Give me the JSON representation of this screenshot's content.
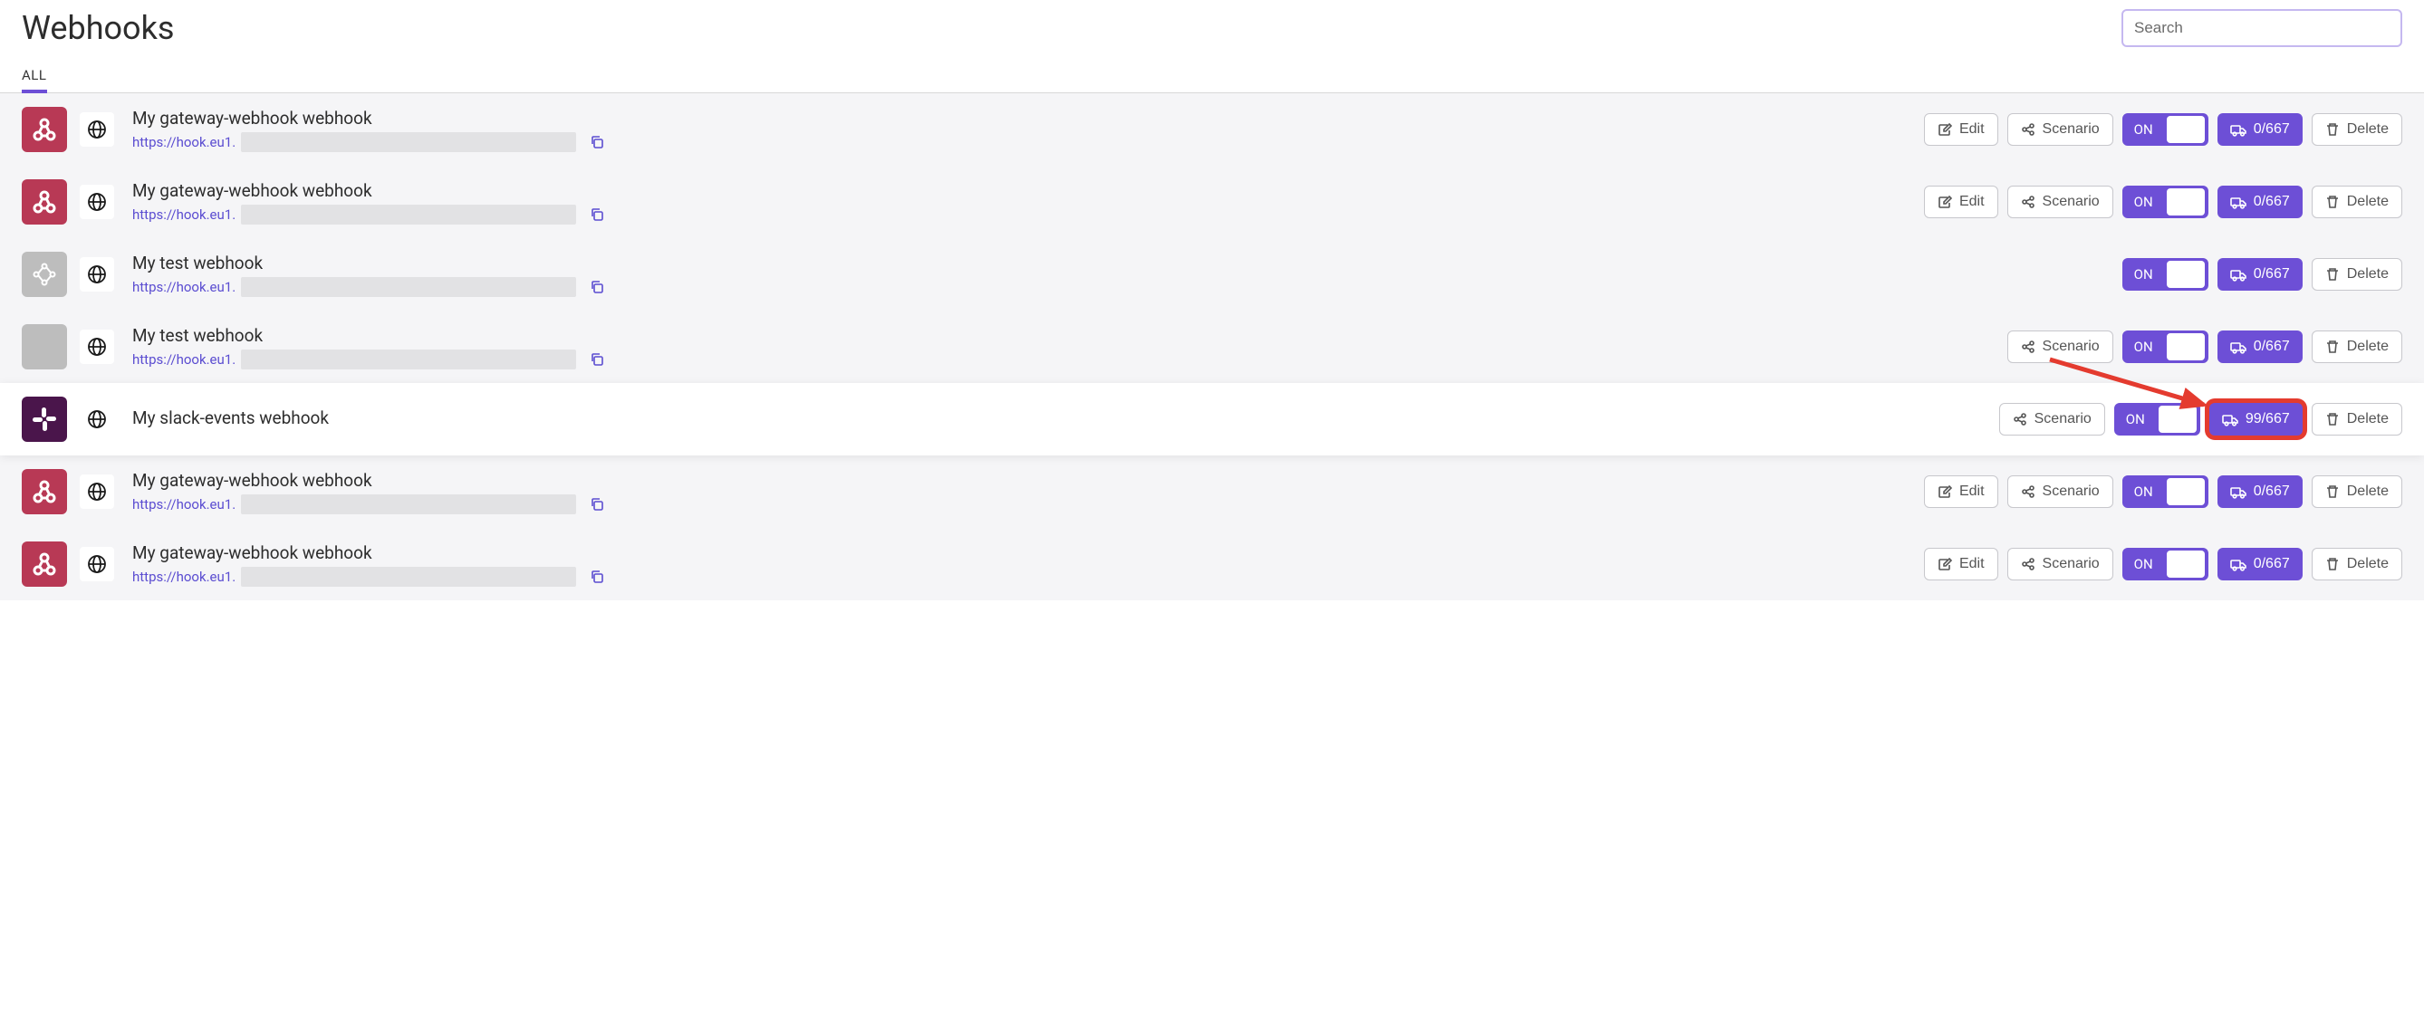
{
  "header": {
    "title": "Webhooks",
    "search_placeholder": "Search"
  },
  "tabs": {
    "all": "ALL"
  },
  "buttons": {
    "edit": "Edit",
    "scenario": "Scenario",
    "delete": "Delete",
    "toggle_on": "ON"
  },
  "url_prefix": "https://hook.eu1.",
  "webhooks": [
    {
      "name": "My gateway-webhook webhook",
      "icon": "webhook",
      "show_url": true,
      "show_edit": true,
      "show_scenario": true,
      "queue": "0/667",
      "queue_boxed": false,
      "highlighted": false
    },
    {
      "name": "My gateway-webhook webhook",
      "icon": "webhook",
      "show_url": true,
      "show_edit": true,
      "show_scenario": true,
      "queue": "0/667",
      "queue_boxed": false,
      "highlighted": false
    },
    {
      "name": "My test webhook",
      "icon": "gray",
      "show_url": true,
      "show_edit": false,
      "show_scenario": false,
      "queue": "0/667",
      "queue_boxed": false,
      "highlighted": false
    },
    {
      "name": "My test webhook",
      "icon": "blank",
      "show_url": true,
      "show_edit": false,
      "show_scenario": true,
      "queue": "0/667",
      "queue_boxed": false,
      "highlighted": false
    },
    {
      "name": "My slack-events webhook",
      "icon": "slack",
      "show_url": false,
      "show_edit": false,
      "show_scenario": true,
      "queue": "99/667",
      "queue_boxed": true,
      "highlighted": true
    },
    {
      "name": "My gateway-webhook webhook",
      "icon": "webhook",
      "show_url": true,
      "show_edit": true,
      "show_scenario": true,
      "queue": "0/667",
      "queue_boxed": false,
      "highlighted": false
    },
    {
      "name": "My gateway-webhook webhook",
      "icon": "webhook",
      "show_url": true,
      "show_edit": true,
      "show_scenario": true,
      "queue": "0/667",
      "queue_boxed": false,
      "highlighted": false
    }
  ]
}
